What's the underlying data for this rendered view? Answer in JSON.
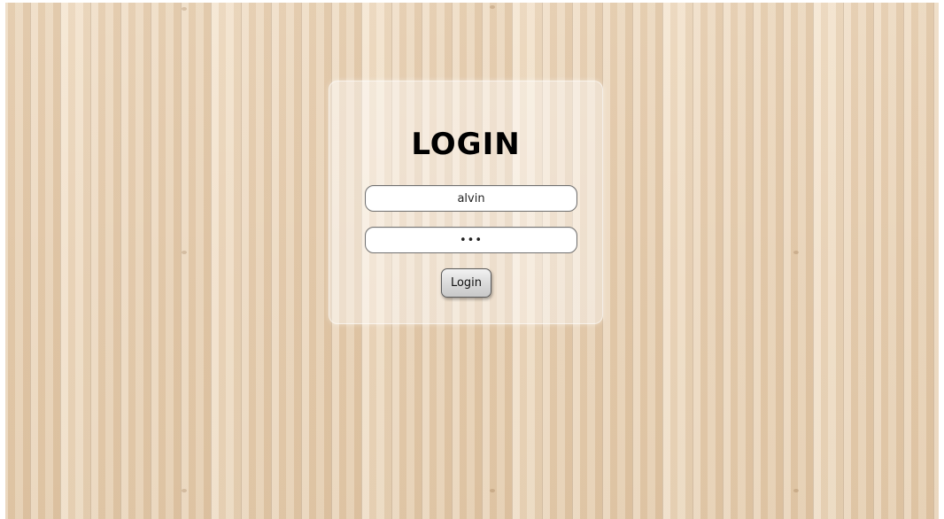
{
  "login": {
    "title": "LOGIN",
    "username_value": "alvin",
    "password_value": "abc",
    "button_label": "Login"
  },
  "colors": {
    "background": "#ead6bc",
    "panel": "rgba(255,255,255,0.42)",
    "text": "#000000",
    "button": "#d9d9d9"
  }
}
